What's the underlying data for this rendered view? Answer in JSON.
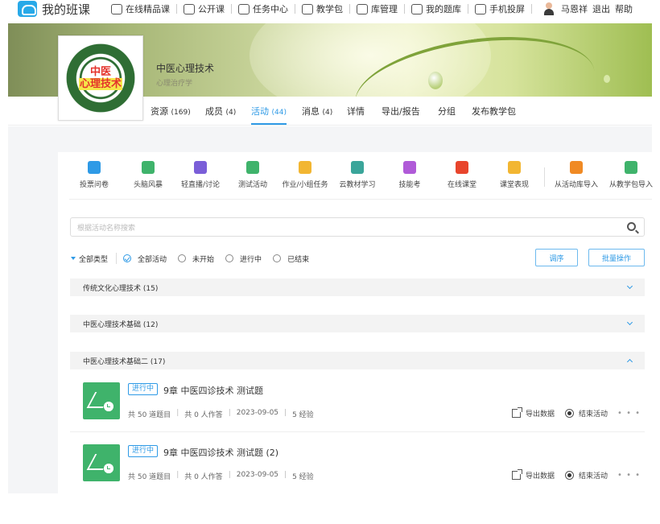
{
  "app": {
    "title": "我的班课"
  },
  "topnav": {
    "items": [
      {
        "label": "在线精品课"
      },
      {
        "label": "公开课"
      },
      {
        "label": "任务中心"
      },
      {
        "label": "教学包"
      },
      {
        "label": "库管理"
      },
      {
        "label": "我的题库"
      },
      {
        "label": "手机投屏"
      }
    ],
    "user_name": "马恩祥",
    "logout": "退出",
    "help": "帮助"
  },
  "course": {
    "title": "中医心理技术",
    "subtitle": "心理治疗学",
    "logo_text_line1": "中医",
    "logo_text_line2": "心理技术"
  },
  "class_tabs": [
    {
      "label": "资源",
      "count": "(169)"
    },
    {
      "label": "成员",
      "count": "(4)"
    },
    {
      "label": "活动",
      "count": "(44)",
      "active": true
    },
    {
      "label": "消息",
      "count": "(4)"
    },
    {
      "label": "详情"
    },
    {
      "label": "导出/报告"
    },
    {
      "label": "分组"
    },
    {
      "label": "发布教学包"
    }
  ],
  "tools": [
    {
      "label": "投票问卷",
      "icon": "bar-chart-icon",
      "color": "#2e9ae6"
    },
    {
      "label": "头脑风暴",
      "icon": "brainstorm-icon",
      "color": "#3fb36b"
    },
    {
      "label": "轻直播/讨论",
      "icon": "live-discussion-icon",
      "color": "#7a5ed8"
    },
    {
      "label": "测试活动",
      "icon": "test-icon",
      "color": "#3fb36b"
    },
    {
      "label": "作业/小组任务",
      "icon": "homework-icon",
      "color": "#f2b632"
    },
    {
      "label": "云教材学习",
      "icon": "cloud-textbook-icon",
      "color": "#3aa59a"
    },
    {
      "label": "技能考",
      "icon": "skill-exam-icon",
      "color": "#b05ad8"
    },
    {
      "label": "在线课堂",
      "icon": "online-class-icon",
      "color": "#e8452c"
    },
    {
      "label": "课堂表现",
      "icon": "class-performance-icon",
      "color": "#f2b632"
    },
    {
      "label": "从活动库导入",
      "icon": "activity-library-import-icon",
      "color": "#f08a24"
    },
    {
      "label": "从教学包导入",
      "icon": "teaching-package-import-icon",
      "color": "#3fb36b"
    }
  ],
  "search": {
    "placeholder": "根据活动名称搜索"
  },
  "filters": {
    "type_label": "全部类型",
    "options": [
      "全部活动",
      "未开始",
      "进行中",
      "已结束"
    ],
    "selected": "全部活动",
    "sort_button": "调序",
    "batch_button": "批量操作"
  },
  "groups": [
    {
      "title": "传统文化心理技术 (15)",
      "expanded": false
    },
    {
      "title": "中医心理技术基础 (12)",
      "expanded": false
    },
    {
      "title": "中医心理技术基础二 (17)",
      "expanded": true
    }
  ],
  "activities": [
    {
      "status": "进行中",
      "title": "9章 中医四诊技术 测试题",
      "questions": "共 50 道题目",
      "answers": "共 0 人作答",
      "date": "2023-09-05",
      "exp": "5 经验",
      "export_label": "导出数据",
      "end_label": "结束活动"
    },
    {
      "status": "进行中",
      "title": "9章 中医四诊技术 测试题 (2)",
      "questions": "共 50 道题目",
      "answers": "共 0 人作答",
      "date": "2023-09-05",
      "exp": "5 经验",
      "export_label": "导出数据",
      "end_label": "结束活动"
    }
  ]
}
